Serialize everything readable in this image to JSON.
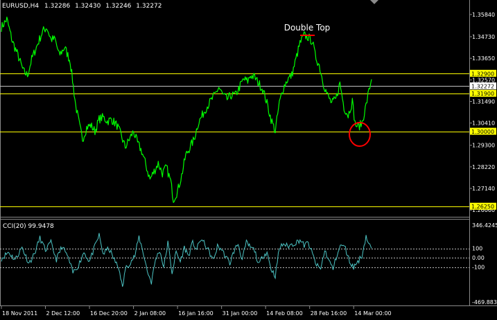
{
  "header": {
    "symbol": "EURUSD,H4",
    "open": "1.32286",
    "high": "1.32430",
    "low": "1.32246",
    "close": "1.32272"
  },
  "annotation": {
    "text": "Double Top"
  },
  "cci_panel": {
    "label": "CCI(20) 99.9478",
    "ticks": [
      "346.4245",
      "100",
      "0.00",
      "-100",
      "-469.8830"
    ]
  },
  "colors": {
    "background": "#000000",
    "price_line": "#00ff00",
    "cci_line": "#4cc4c4",
    "levels": "#ffff00",
    "current_price": "#c0c0c0",
    "double_top": "#ff0000",
    "circle": "#ff0000",
    "axis_text": "#ffffff"
  },
  "chart_data": [
    {
      "type": "line",
      "title": "EURUSD,H4",
      "ylim": [
        1.2586,
        1.3622
      ],
      "y_ticks": [
        1.3584,
        1.3473,
        1.3365,
        1.3257,
        1.3149,
        1.3041,
        1.293,
        1.2822,
        1.2714,
        1.2606
      ],
      "y_tick_labels": [
        "1.35840",
        "1.34730",
        "1.33650",
        "1.32570",
        "1.31490",
        "1.30410",
        "1.29300",
        "1.28220",
        "1.27140",
        "1.26060"
      ],
      "x_tick_labels": [
        "18 Nov 2011",
        "2 Dec 12:00",
        "16 Dec 20:00",
        "2 Jan 08:00",
        "16 Jan 16:00",
        "31 Jan 00:00",
        "14 Feb 08:00",
        "28 Feb 16:00",
        "14 Mar 00:00"
      ],
      "horizontal_levels": [
        {
          "value": 1.329,
          "label": "1.32900"
        },
        {
          "value": 1.319,
          "label": "1.31900"
        },
        {
          "value": 1.3,
          "label": "1.30000"
        },
        {
          "value": 1.2625,
          "label": "1.26250"
        }
      ],
      "current_price": {
        "value": 1.32272,
        "label": "1.32272"
      },
      "series": [
        {
          "points": [
            [
              0,
              1.352
            ],
            [
              8,
              1.356
            ],
            [
              16,
              1.345
            ],
            [
              24,
              1.338
            ],
            [
              32,
              1.33
            ],
            [
              38,
              1.328
            ],
            [
              44,
              1.336
            ],
            [
              52,
              1.343
            ],
            [
              60,
              1.35
            ],
            [
              66,
              1.352
            ],
            [
              72,
              1.346
            ],
            [
              78,
              1.346
            ],
            [
              84,
              1.338
            ],
            [
              92,
              1.342
            ],
            [
              100,
              1.335
            ],
            [
              108,
              1.313
            ],
            [
              114,
              1.302
            ],
            [
              118,
              1.296
            ],
            [
              124,
              1.302
            ],
            [
              130,
              1.303
            ],
            [
              136,
              1.3
            ],
            [
              142,
              1.306
            ],
            [
              148,
              1.307
            ],
            [
              154,
              1.305
            ],
            [
              160,
              1.306
            ],
            [
              168,
              1.303
            ],
            [
              174,
              1.298
            ],
            [
              180,
              1.292
            ],
            [
              186,
              1.296
            ],
            [
              192,
              1.3
            ],
            [
              198,
              1.294
            ],
            [
              204,
              1.29
            ],
            [
              210,
              1.283
            ],
            [
              216,
              1.276
            ],
            [
              222,
              1.28
            ],
            [
              228,
              1.284
            ],
            [
              234,
              1.279
            ],
            [
              240,
              1.282
            ],
            [
              246,
              1.275
            ],
            [
              250,
              1.266
            ],
            [
              256,
              1.27
            ],
            [
              262,
              1.278
            ],
            [
              268,
              1.288
            ],
            [
              274,
              1.292
            ],
            [
              280,
              1.296
            ],
            [
              286,
              1.304
            ],
            [
              292,
              1.308
            ],
            [
              298,
              1.312
            ],
            [
              304,
              1.315
            ],
            [
              310,
              1.318
            ],
            [
              316,
              1.322
            ],
            [
              322,
              1.318
            ],
            [
              328,
              1.316
            ],
            [
              334,
              1.318
            ],
            [
              340,
              1.318
            ],
            [
              346,
              1.322
            ],
            [
              352,
              1.326
            ],
            [
              358,
              1.325
            ],
            [
              362,
              1.328
            ],
            [
              368,
              1.327
            ],
            [
              374,
              1.324
            ],
            [
              380,
              1.321
            ],
            [
              386,
              1.314
            ],
            [
              392,
              1.306
            ],
            [
              398,
              1.3
            ],
            [
              404,
              1.314
            ],
            [
              410,
              1.322
            ],
            [
              416,
              1.326
            ],
            [
              422,
              1.328
            ],
            [
              428,
              1.336
            ],
            [
              434,
              1.344
            ],
            [
              440,
              1.348
            ],
            [
              446,
              1.347
            ],
            [
              452,
              1.345
            ],
            [
              456,
              1.338
            ],
            [
              462,
              1.333
            ],
            [
              468,
              1.324
            ],
            [
              474,
              1.318
            ],
            [
              480,
              1.314
            ],
            [
              486,
              1.316
            ],
            [
              492,
              1.324
            ],
            [
              498,
              1.312
            ],
            [
              504,
              1.308
            ],
            [
              510,
              1.315
            ],
            [
              514,
              1.304
            ],
            [
              518,
              1.302
            ],
            [
              524,
              1.304
            ],
            [
              530,
              1.313
            ],
            [
              534,
              1.32
            ],
            [
              538,
              1.326
            ]
          ]
        }
      ]
    },
    {
      "type": "line",
      "title": "CCI(20) 99.9478",
      "ylim": [
        -469.883,
        346.4245
      ],
      "reference_levels": [
        100,
        0,
        -100
      ],
      "series": [
        {
          "points": [
            [
              0,
              -10
            ],
            [
              10,
              60
            ],
            [
              20,
              -20
            ],
            [
              30,
              110
            ],
            [
              40,
              -60
            ],
            [
              48,
              40
            ],
            [
              56,
              210
            ],
            [
              64,
              80
            ],
            [
              72,
              160
            ],
            [
              80,
              -20
            ],
            [
              88,
              120
            ],
            [
              96,
              20
            ],
            [
              104,
              -160
            ],
            [
              112,
              -80
            ],
            [
              120,
              60
            ],
            [
              128,
              -40
            ],
            [
              136,
              120
            ],
            [
              142,
              240
            ],
            [
              148,
              40
            ],
            [
              156,
              100
            ],
            [
              164,
              -20
            ],
            [
              172,
              -140
            ],
            [
              176,
              -330
            ],
            [
              180,
              -120
            ],
            [
              186,
              -60
            ],
            [
              194,
              20
            ],
            [
              200,
              220
            ],
            [
              206,
              60
            ],
            [
              212,
              -140
            ],
            [
              218,
              -260
            ],
            [
              224,
              -20
            ],
            [
              230,
              80
            ],
            [
              236,
              -100
            ],
            [
              242,
              160
            ],
            [
              248,
              -160
            ],
            [
              254,
              60
            ],
            [
              260,
              -40
            ],
            [
              266,
              110
            ],
            [
              272,
              20
            ],
            [
              278,
              160
            ],
            [
              284,
              90
            ],
            [
              290,
              200
            ],
            [
              296,
              140
            ],
            [
              302,
              60
            ],
            [
              308,
              -30
            ],
            [
              314,
              120
            ],
            [
              320,
              90
            ],
            [
              326,
              10
            ],
            [
              332,
              -60
            ],
            [
              338,
              70
            ],
            [
              344,
              150
            ],
            [
              350,
              -20
            ],
            [
              356,
              160
            ],
            [
              362,
              110
            ],
            [
              368,
              80
            ],
            [
              374,
              -80
            ],
            [
              380,
              20
            ],
            [
              386,
              60
            ],
            [
              392,
              -120
            ],
            [
              398,
              -190
            ],
            [
              404,
              100
            ],
            [
              410,
              150
            ],
            [
              416,
              120
            ],
            [
              422,
              140
            ],
            [
              428,
              160
            ],
            [
              434,
              190
            ],
            [
              440,
              130
            ],
            [
              446,
              160
            ],
            [
              452,
              40
            ],
            [
              458,
              -80
            ],
            [
              464,
              -120
            ],
            [
              470,
              80
            ],
            [
              476,
              -30
            ],
            [
              482,
              -120
            ],
            [
              488,
              40
            ],
            [
              494,
              140
            ],
            [
              500,
              100
            ],
            [
              506,
              -40
            ],
            [
              512,
              -100
            ],
            [
              518,
              -40
            ],
            [
              524,
              20
            ],
            [
              530,
              230
            ],
            [
              534,
              140
            ],
            [
              538,
              100
            ]
          ]
        }
      ]
    }
  ]
}
